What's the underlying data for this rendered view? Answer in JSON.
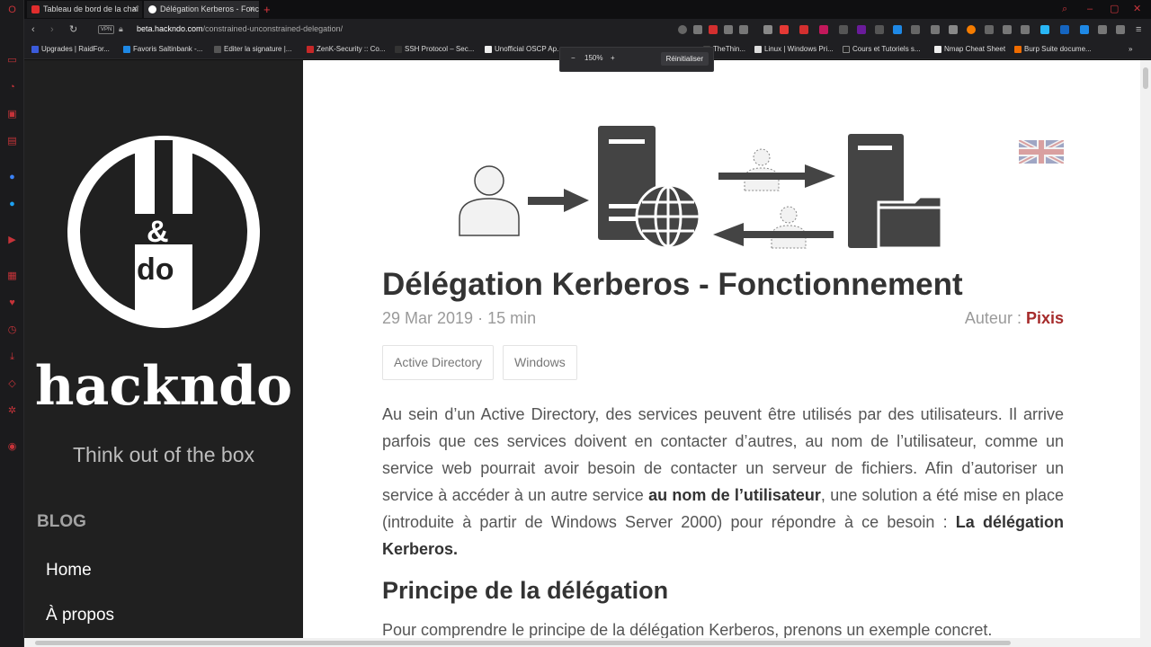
{
  "browser": {
    "tabs": [
      {
        "label": "Tableau de bord de la chaî",
        "favicon_color": "#e02d2d"
      },
      {
        "label": "Délégation Kerberos - Fonc",
        "favicon_color": "#ffffff"
      }
    ],
    "url_host": "beta.hackndo.com",
    "url_path": "/constrained-unconstrained-delegation/",
    "vpn_label": "VPN",
    "zoom_level": "150%",
    "zoom_minus": "−",
    "zoom_plus": "+",
    "zoom_reset_label": "Réinitialiser",
    "bookmarks": [
      {
        "label": "Upgrades | RaidFor...",
        "color": "#3b5bdb"
      },
      {
        "label": "Favoris Saltinbank -...",
        "color": "#1e88e5"
      },
      {
        "label": "Editer la signature |...",
        "color": "#555555"
      },
      {
        "label": "ZenK-Security :: Co...",
        "color": "#c62828"
      },
      {
        "label": "SSH Protocol – Sec...",
        "color": "#333333"
      },
      {
        "label": "Unofficial OSCP Ap...",
        "color": "#eeeeee"
      },
      {
        "label": "TheThin...",
        "color": "#444444"
      },
      {
        "label": "Linux | Windows Pri...",
        "color": "#dddddd"
      },
      {
        "label": "Cours et Tutoriels s...",
        "color": "#222222"
      },
      {
        "label": "Nmap Cheat Sheet",
        "color": "#eeeeee"
      },
      {
        "label": "Burp Suite docume...",
        "color": "#ef6c00"
      }
    ],
    "bookmarks_more": "»"
  },
  "sidebar": {
    "logo_text_top": "&",
    "logo_text_bottom": "do",
    "site_name": "hackndo",
    "tagline": "Think out of the box",
    "blog_heading": "BLOG",
    "nav": [
      {
        "label": "Home"
      },
      {
        "label": "À propos"
      }
    ]
  },
  "post": {
    "title": "Délégation Kerberos - Fonctionnement",
    "date": "29 Mar 2019",
    "separator": "·",
    "read_time": "15 min",
    "author_label": "Auteur :",
    "author_name": "Pixis",
    "tags": [
      "Active Directory",
      "Windows"
    ],
    "intro_part1": "Au sein d’un Active Directory, des services peuvent être utilisés par des utilisateurs. Il arrive parfois que ces services doivent en contacter d’autres, au nom de l’utilisateur, comme un service web pourrait avoir besoin de contacter un serveur de fichiers. Afin d’autoriser un service à accéder à un autre service",
    "intro_bold1": "au nom de l’utilisateur",
    "intro_part2": ", une solution a été mise en place (introduite à partir de Windows Server 2000) pour répondre à ce besoin :",
    "intro_bold2": "La délégation Kerberos.",
    "section_heading": "Principe de la délégation",
    "section_text": "Pour comprendre le principe de la délégation Kerberos, prenons un exemple concret."
  },
  "colors": {
    "sidebar_bg": "#202020",
    "author_accent": "#a62b2b",
    "browser_accent": "#c8353c"
  }
}
